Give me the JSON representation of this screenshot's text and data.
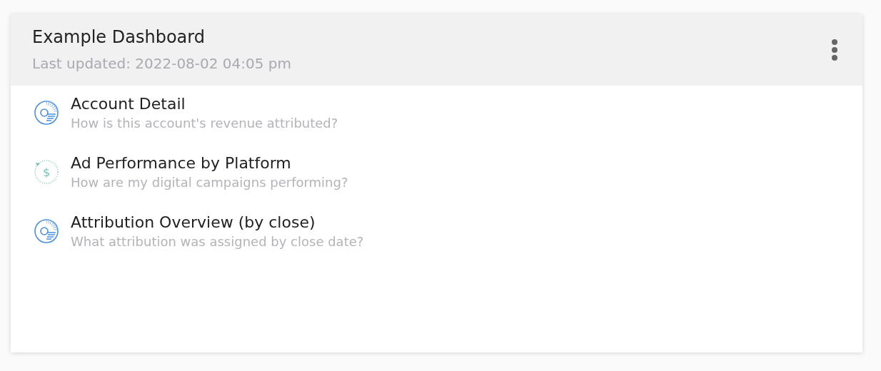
{
  "dashboard": {
    "title": "Example Dashboard",
    "subtitle": "Last updated: 2022-08-02 04:05 pm"
  },
  "reports": [
    {
      "kind": "donut",
      "title": "Account Detail",
      "description": "How is this account's revenue attributed?"
    },
    {
      "kind": "revenue",
      "symbol": "$",
      "title": "Ad Performance by Platform",
      "description": "How are my digital campaigns performing?"
    },
    {
      "kind": "donut",
      "title": "Attribution Overview (by close)",
      "description": "What attribution was assigned by close date?"
    }
  ]
}
